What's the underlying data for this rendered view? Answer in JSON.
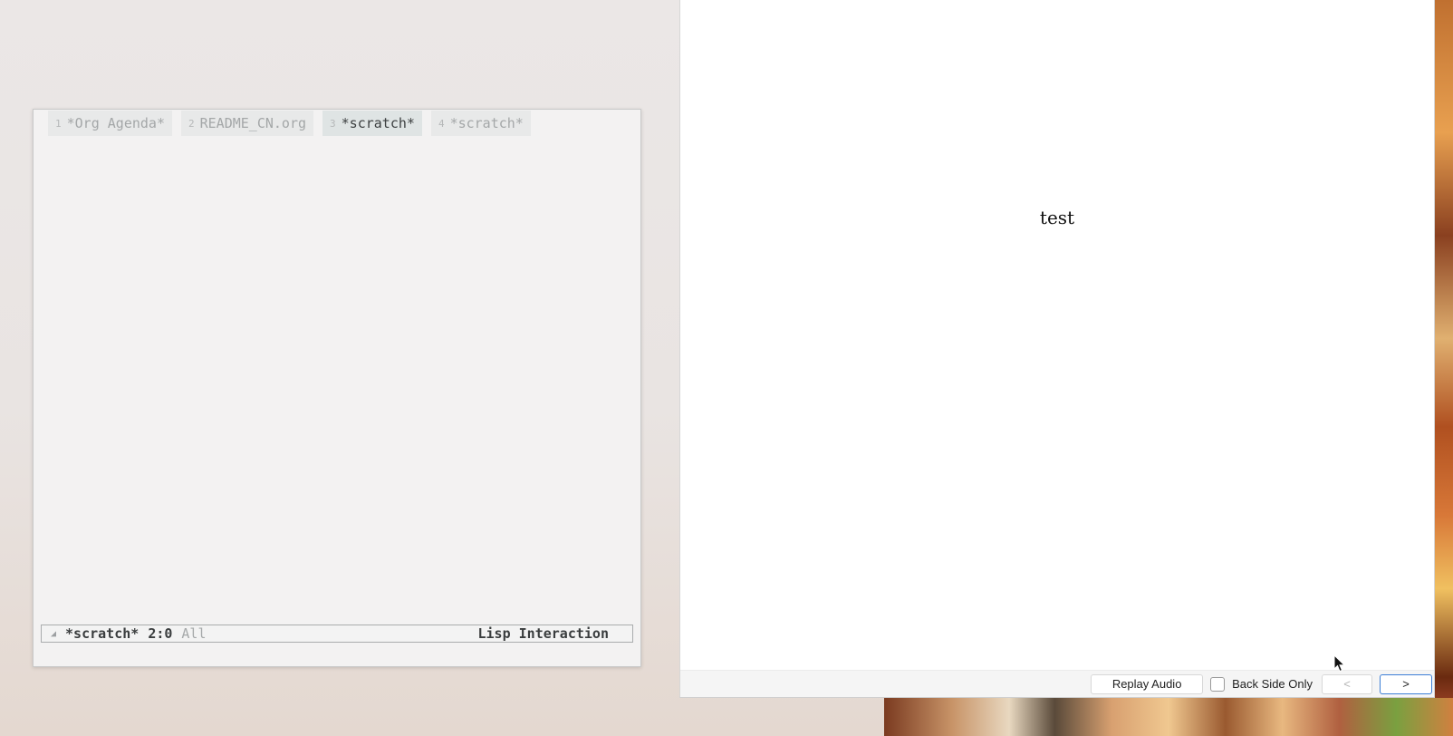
{
  "emacs": {
    "tabs": [
      {
        "num": "1",
        "label": "*Org Agenda*",
        "active": false
      },
      {
        "num": "2",
        "label": "README_CN.org",
        "active": false
      },
      {
        "num": "3",
        "label": "*scratch*",
        "active": true
      },
      {
        "num": "4",
        "label": "*scratch*",
        "active": false
      }
    ],
    "mode_line": {
      "indicator": "◢",
      "buffer_name": "*scratch*",
      "position": "2:0",
      "scope": "All",
      "major_mode": "Lisp Interaction"
    }
  },
  "card": {
    "content": "test",
    "bottom_bar": {
      "replay_label": "Replay Audio",
      "back_side_label": "Back Side Only",
      "back_side_checked": false,
      "prev_label": "<",
      "next_label": ">"
    }
  },
  "colors": {
    "accent_blue": "#3d7fd6",
    "emacs_bg": "#f3f2f2"
  }
}
